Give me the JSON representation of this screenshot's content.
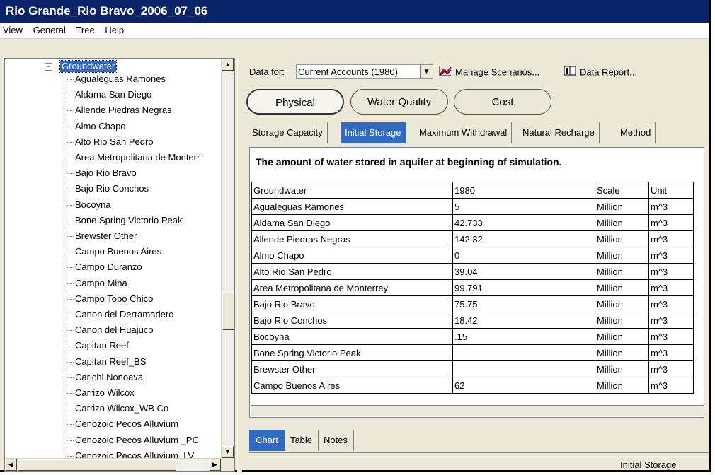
{
  "window": {
    "title": "Rio Grande_Rio Bravo_2006_07_06"
  },
  "menu": [
    "View",
    "General",
    "Tree",
    "Help"
  ],
  "tree": {
    "root_label": "Groundwater",
    "items": [
      "Agualeguas Ramones",
      "Aldama San Diego",
      "Allende Piedras Negras",
      "Almo Chapo",
      "Alto Rio San Pedro",
      "Area Metropolitana de Monterr",
      "Bajo Rio Bravo",
      "Bajo Rio Conchos",
      "Bocoyna",
      "Bone Spring Victorio Peak",
      "Brewster Other",
      "Campo Buenos  Aires",
      "Campo Duranzo",
      "Campo Mina",
      "Campo Topo Chico",
      "Canon del Derramadero",
      "Canon del Huajuco",
      "Capitan Reef",
      "Capitan Reef_BS",
      "Carichi Nonoava",
      "Carrizo Wilcox",
      "Carrizo Wilcox_WB Co",
      "Cenozoic Pecos Alluvium",
      "Cenozoic Pecos Alluvium _PC",
      "Cenozoic Pecos Alluvium_LV"
    ]
  },
  "toolbar": {
    "data_for_label": "Data for:",
    "scenario_value": "Current Accounts (1980)",
    "manage_scenarios_label": "Manage Scenarios...",
    "data_report_label": "Data Report..."
  },
  "categories": [
    "Physical",
    "Water Quality",
    "Cost"
  ],
  "tabs": [
    "Storage Capacity",
    "Initial Storage",
    "Maximum Withdrawal",
    "Natural Recharge",
    "Method"
  ],
  "active_tab": "Initial Storage",
  "description": "The amount of water stored in aquifer at beginning of simulation.",
  "table": {
    "headers": [
      "Groundwater",
      "1980",
      "Scale",
      "Unit"
    ],
    "rows": [
      [
        "Agualeguas Ramones",
        "5",
        "Million",
        "m^3"
      ],
      [
        "Aldama San Diego",
        "42.733",
        "Million",
        "m^3"
      ],
      [
        "Allende Piedras Negras",
        "142.32",
        "Million",
        "m^3"
      ],
      [
        "Almo Chapo",
        "0",
        "Million",
        "m^3"
      ],
      [
        "Alto Rio San Pedro",
        "39.04",
        "Million",
        "m^3"
      ],
      [
        "Area Metropolitana de Monterrey",
        "99.791",
        "Million",
        "m^3"
      ],
      [
        "Bajo Rio Bravo",
        "75.75",
        "Million",
        "m^3"
      ],
      [
        "Bajo Rio Conchos",
        "18.42",
        "Million",
        "m^3"
      ],
      [
        "Bocoyna",
        ".15",
        "Million",
        "m^3"
      ],
      [
        "Bone Spring Victorio Peak",
        "",
        "Million",
        "m^3"
      ],
      [
        "Brewster Other",
        "",
        "Million",
        "m^3"
      ],
      [
        "Campo Buenos  Aires",
        "62",
        "Million",
        "m^3"
      ]
    ]
  },
  "bottom_tabs": [
    "Chart",
    "Table",
    "Notes"
  ],
  "status_text": "Initial Storage",
  "colors": {
    "title_bar": "#0a246a",
    "selection": "#316ac5",
    "window": "#ece9d8"
  }
}
